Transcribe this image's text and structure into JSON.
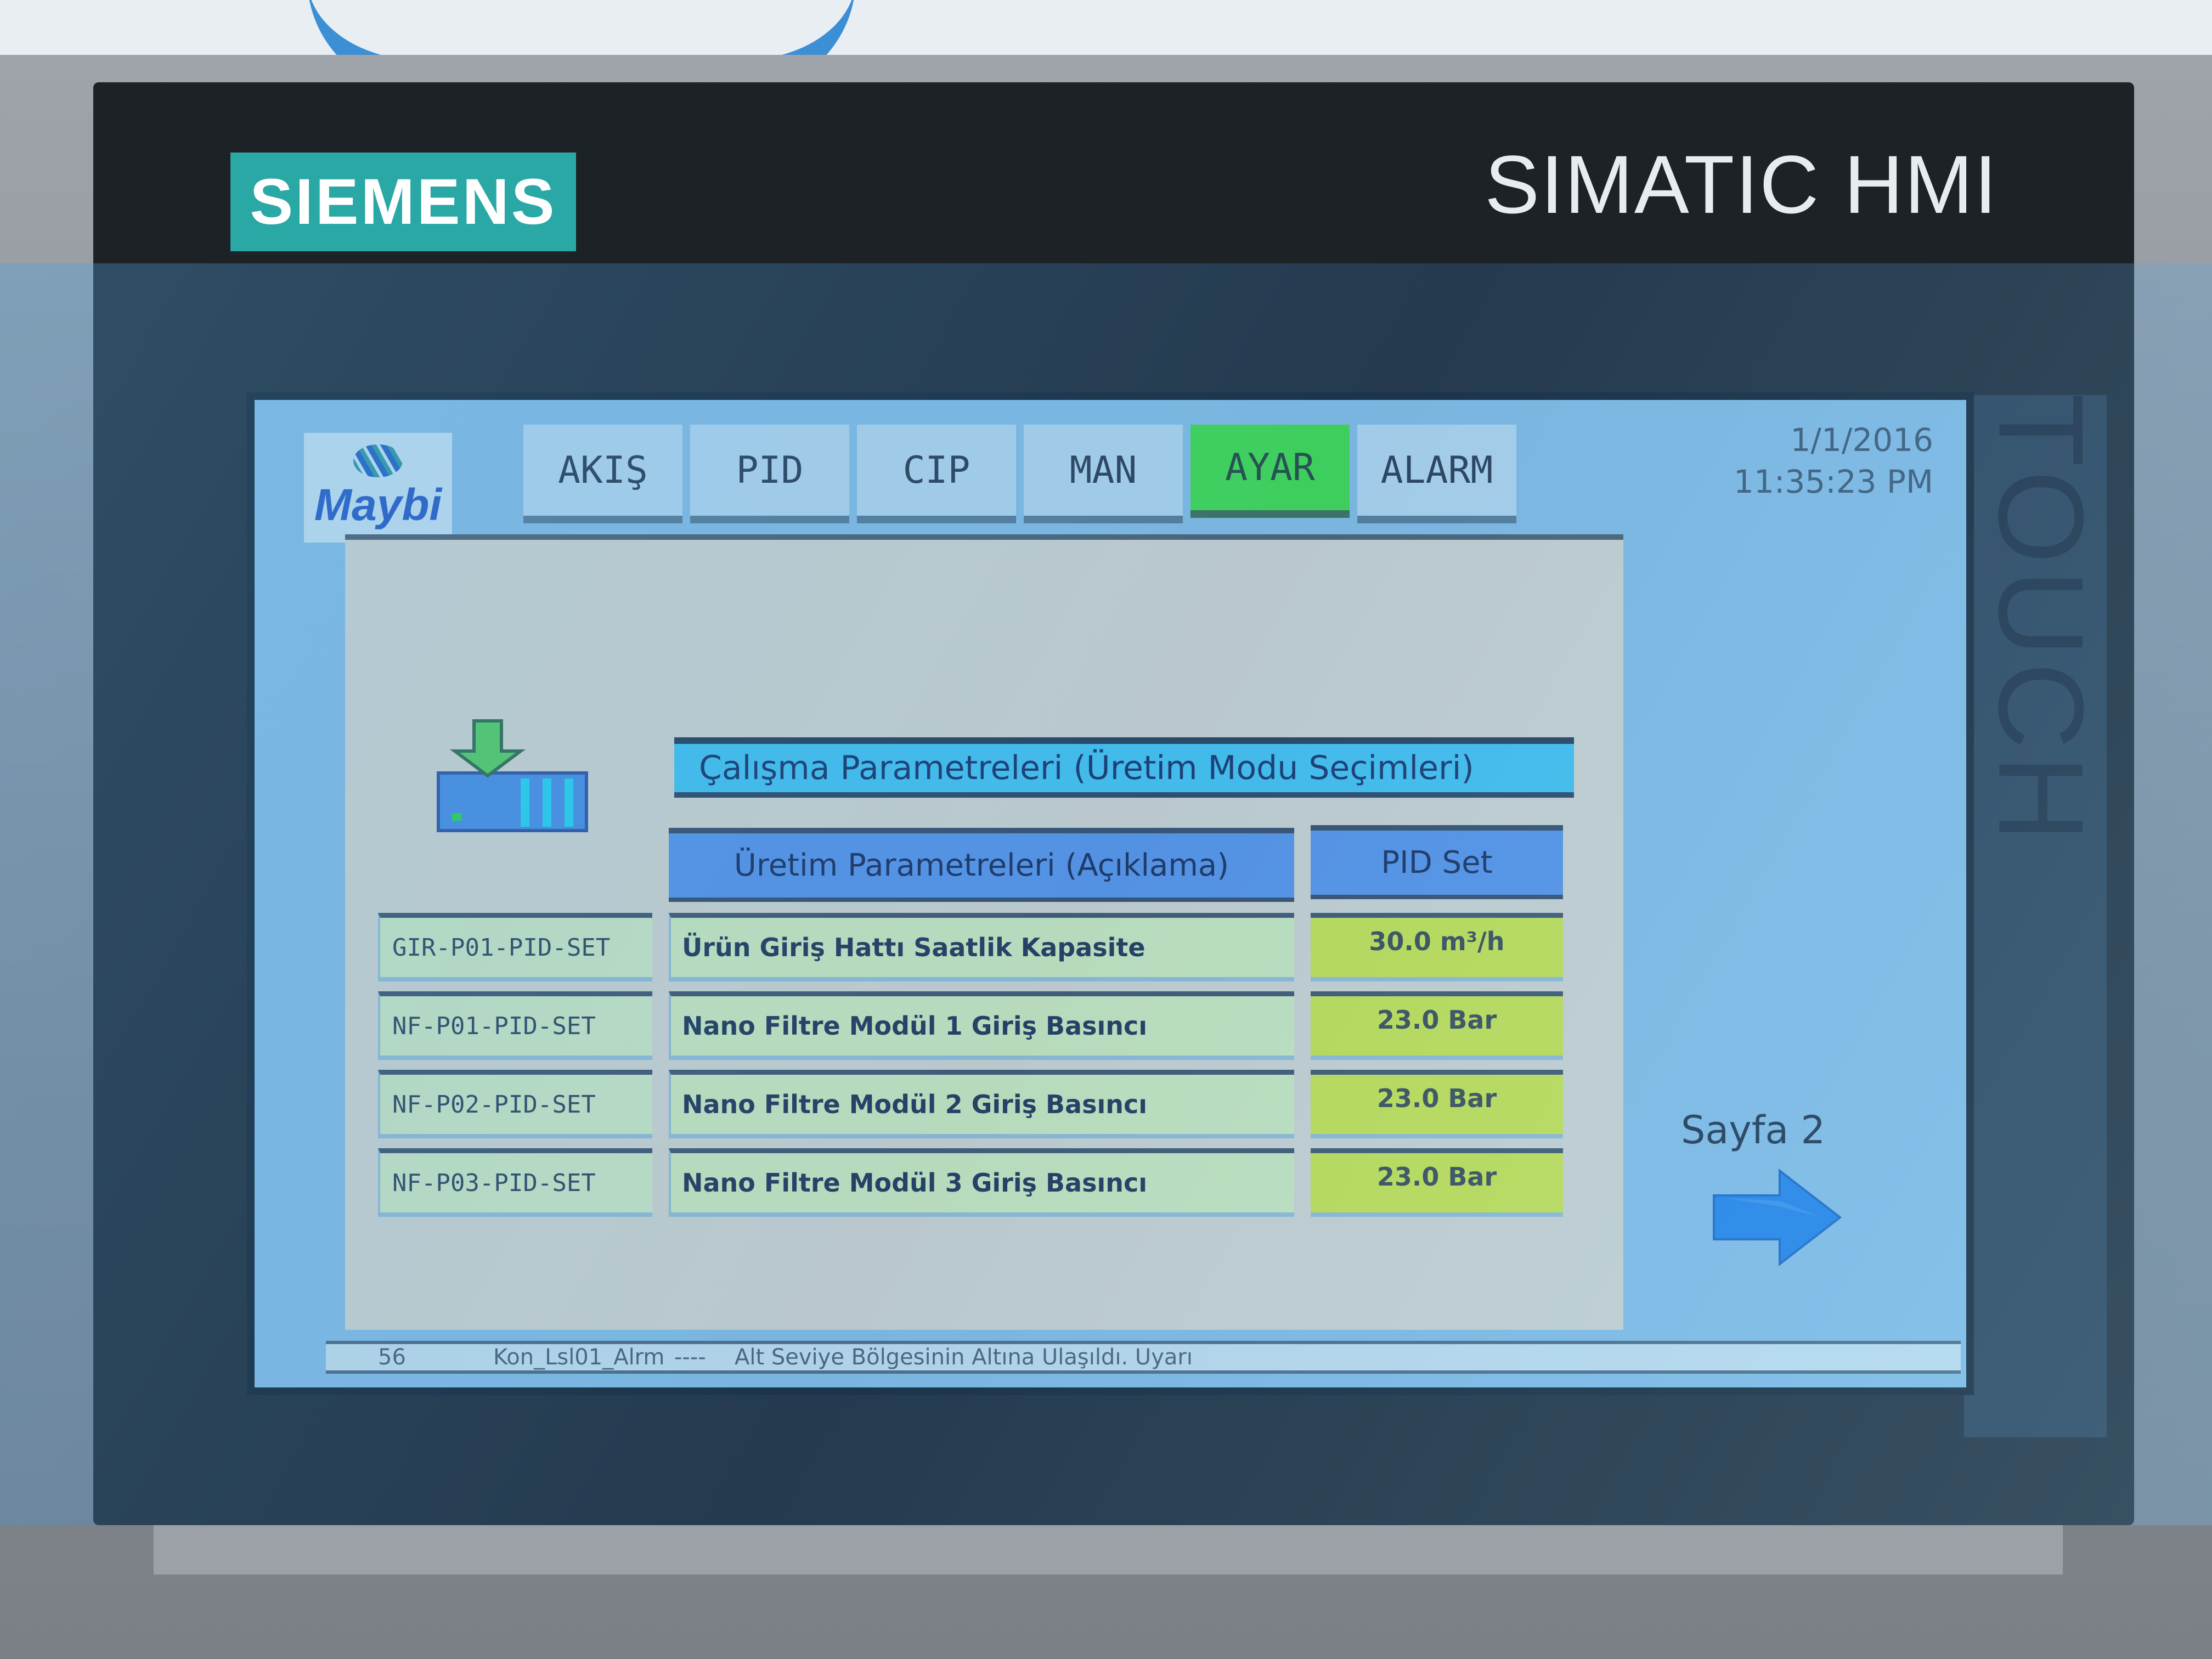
{
  "device": {
    "brand": "SIEMENS",
    "model_label": "SIMATIC HMI",
    "side_label": "TOUCH"
  },
  "header": {
    "logo_text": "Maybi",
    "tabs": [
      {
        "label": "AKIŞ",
        "active": false
      },
      {
        "label": "PID",
        "active": false
      },
      {
        "label": "CIP",
        "active": false
      },
      {
        "label": "MAN",
        "active": false
      },
      {
        "label": "AYAR",
        "active": true
      },
      {
        "label": "ALARM",
        "active": false
      }
    ],
    "date": "1/1/2016",
    "time": "11:35:23 PM"
  },
  "main": {
    "title": "Çalışma Parametreleri (Üretim Modu Seçimleri)",
    "columns": {
      "description": "Üretim Parametreleri (Açıklama)",
      "pid_set": "PID Set"
    },
    "rows": [
      {
        "tag": "GIR-P01-PID-SET",
        "description": "Ürün Giriş Hattı Saatlik Kapasite",
        "value": "30.0 m³/h"
      },
      {
        "tag": "NF-P01-PID-SET",
        "description": "Nano Filtre Modül 1 Giriş Basıncı",
        "value": "23.0 Bar"
      },
      {
        "tag": "NF-P02-PID-SET",
        "description": "Nano Filtre Modül 2 Giriş Basıncı",
        "value": "23.0 Bar"
      },
      {
        "tag": "NF-P03-PID-SET",
        "description": "Nano Filtre Modül 3 Giriş Basıncı",
        "value": "23.0 Bar"
      }
    ],
    "next_page_label": "Sayfa 2"
  },
  "alarm_line": {
    "number": "56",
    "tag": "Kon_Lsl01_Alrm",
    "separator": "----",
    "message": "Alt Seviye Bölgesinin Altına Ulaşıldı. Uyarı"
  },
  "colors": {
    "active_tab": "#3fe73a",
    "title_bar": "#44ccf5",
    "column_header": "#5b96ec",
    "value_cell": "#dbf23a",
    "screen_bg": "#8ec6e8",
    "brand_teal": "#2aa8a6"
  }
}
